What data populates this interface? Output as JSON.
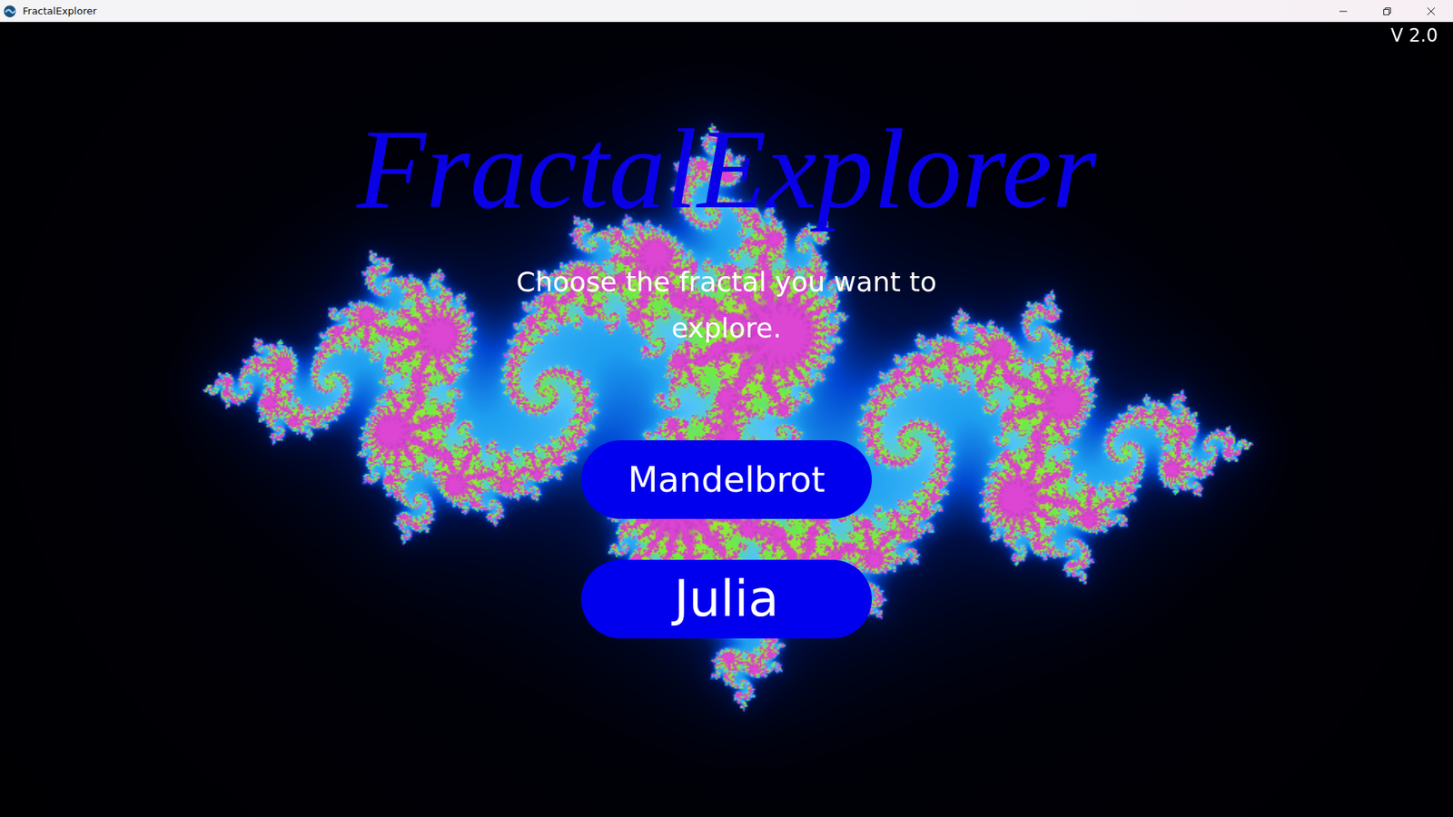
{
  "window": {
    "title": "FractalExplorer"
  },
  "version": "V 2.0",
  "heading": "FractalExplorer",
  "prompt": "Choose the fractal you want to explore.",
  "buttons": [
    "Mandelbrot",
    "Julia"
  ]
}
